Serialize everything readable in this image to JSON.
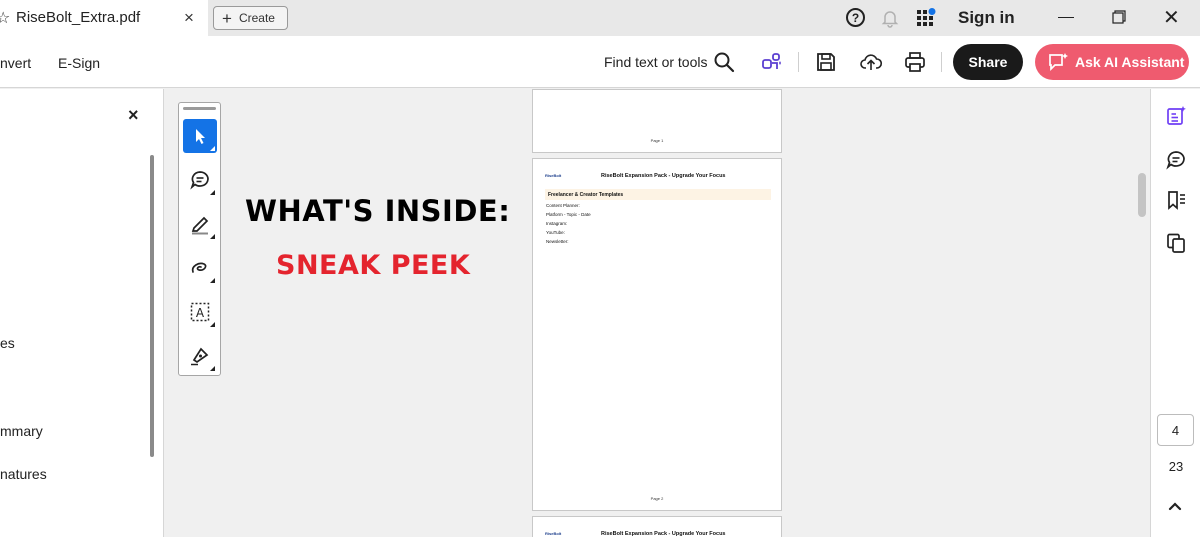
{
  "tab": {
    "title": "RiseBolt_Extra.pdf",
    "close": "×"
  },
  "create": {
    "label": "Create"
  },
  "titlebar": {
    "help": "?",
    "signin": "Sign in"
  },
  "menu": {
    "convert": "nvert",
    "esign": "E-Sign"
  },
  "toolbar": {
    "find_label": "Find text or tools",
    "share_label": "Share",
    "ai_label": "Ask AI Assistant"
  },
  "left_panel": {
    "close": "×",
    "items": [
      "es",
      "mmary",
      "natures"
    ]
  },
  "content": {
    "headline": "WHAT'S INSIDE:",
    "subheadline": "SNEAK PEEK"
  },
  "pages": {
    "page1_label": "Page 1",
    "page2_label": "Page 2",
    "logo": "RiseBolt",
    "title": "RiseBolt Expansion Pack - Upgrade Your Focus",
    "section": "Freelancer & Creator Templates",
    "lines": [
      "Content Planner:",
      "Platform - Topic - Date",
      "Instagram:",
      "YouTube:",
      "Newsletter:"
    ]
  },
  "navigation": {
    "current_page": "4",
    "total_pages": "23"
  },
  "colors": {
    "accent_blue": "#1473e6",
    "ai_button": "#ef5b6f",
    "sneak_red": "#e4242e",
    "share_bg": "#1a1a1a",
    "rail_purple": "#6f3ff5"
  }
}
